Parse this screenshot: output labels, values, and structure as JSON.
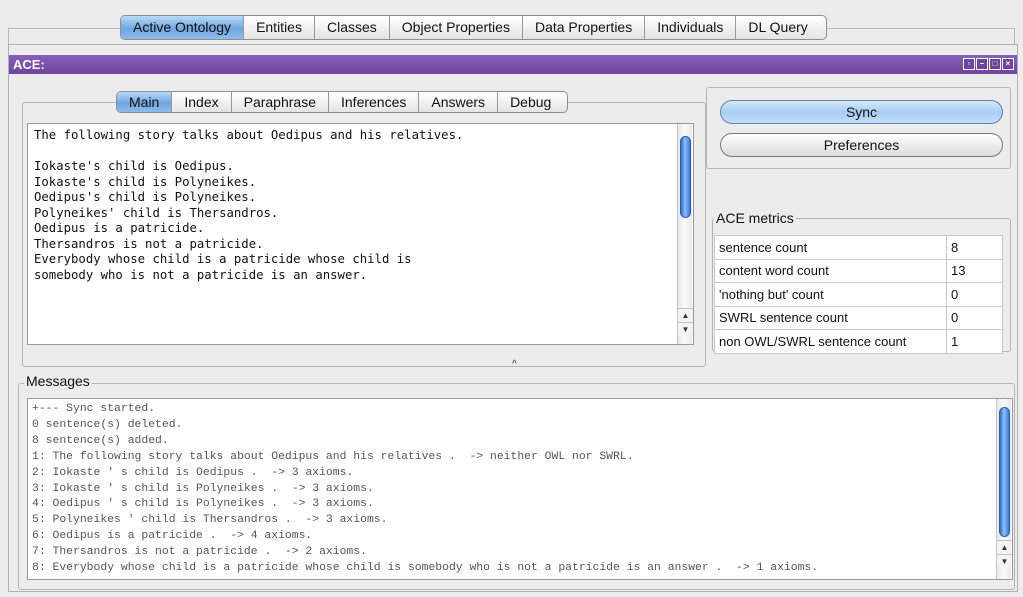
{
  "top_tabs": [
    "Active Ontology",
    "Entities",
    "Classes",
    "Object Properties",
    "Data Properties",
    "Individuals",
    "DL Query"
  ],
  "selected_top_tab": "Active Ontology",
  "window": {
    "title": "ACE:"
  },
  "editor_tabs": [
    "Main",
    "Index",
    "Paraphrase",
    "Inferences",
    "Answers",
    "Debug"
  ],
  "selected_editor_tab": "Main",
  "editor_text": "The following story talks about Oedipus and his relatives.\n\nIokaste's child is Oedipus.\nIokaste's child is Polyneikes.\nOedipus's child is Polyneikes.\nPolyneikes' child is Thersandros.\nOedipus is a patricide.\nThersandros is not a patricide.\nEverybody whose child is a patricide whose child is\nsomebody who is not a patricide is an answer.",
  "buttons": {
    "sync": "Sync",
    "preferences": "Preferences"
  },
  "metrics": {
    "title": "ACE metrics",
    "rows": [
      {
        "label": "sentence count",
        "value": "8"
      },
      {
        "label": "content word count",
        "value": "13"
      },
      {
        "label": "'nothing but' count",
        "value": "0"
      },
      {
        "label": "SWRL sentence count",
        "value": "0"
      },
      {
        "label": "non OWL/SWRL sentence count",
        "value": "1"
      }
    ]
  },
  "messages": {
    "title": "Messages",
    "lines": [
      "+--- Sync started.",
      "0 sentence(s) deleted.",
      "8 sentence(s) added.",
      "1: The following story talks about Oedipus and his relatives .  -> neither OWL nor SWRL.",
      "2: Iokaste ' s child is Oedipus .  -> 3 axioms.",
      "3: Iokaste ' s child is Polyneikes .  -> 3 axioms.",
      "4: Oedipus ' s child is Polyneikes .  -> 3 axioms.",
      "5: Polyneikes ' child is Thersandros .  -> 3 axioms.",
      "6: Oedipus is a patricide .  -> 4 axioms.",
      "7: Thersandros is not a patricide .  -> 2 axioms.",
      "8: Everybody whose child is a patricide whose child is somebody who is not a patricide is an answer .  -> 1 axioms."
    ]
  },
  "icons": {
    "window_buttons": [
      "float-icon",
      "minimize-icon",
      "maximize-icon",
      "close-icon"
    ],
    "scroll_up": "scroll-up-arrow-icon",
    "scroll_down": "scroll-down-arrow-icon",
    "splitter": "splitter-caret-icon"
  },
  "colors": {
    "titlebar": "#6d45a0",
    "selected_tab": "#6fa6df",
    "scroll_thumb": "#2c6bd0"
  }
}
